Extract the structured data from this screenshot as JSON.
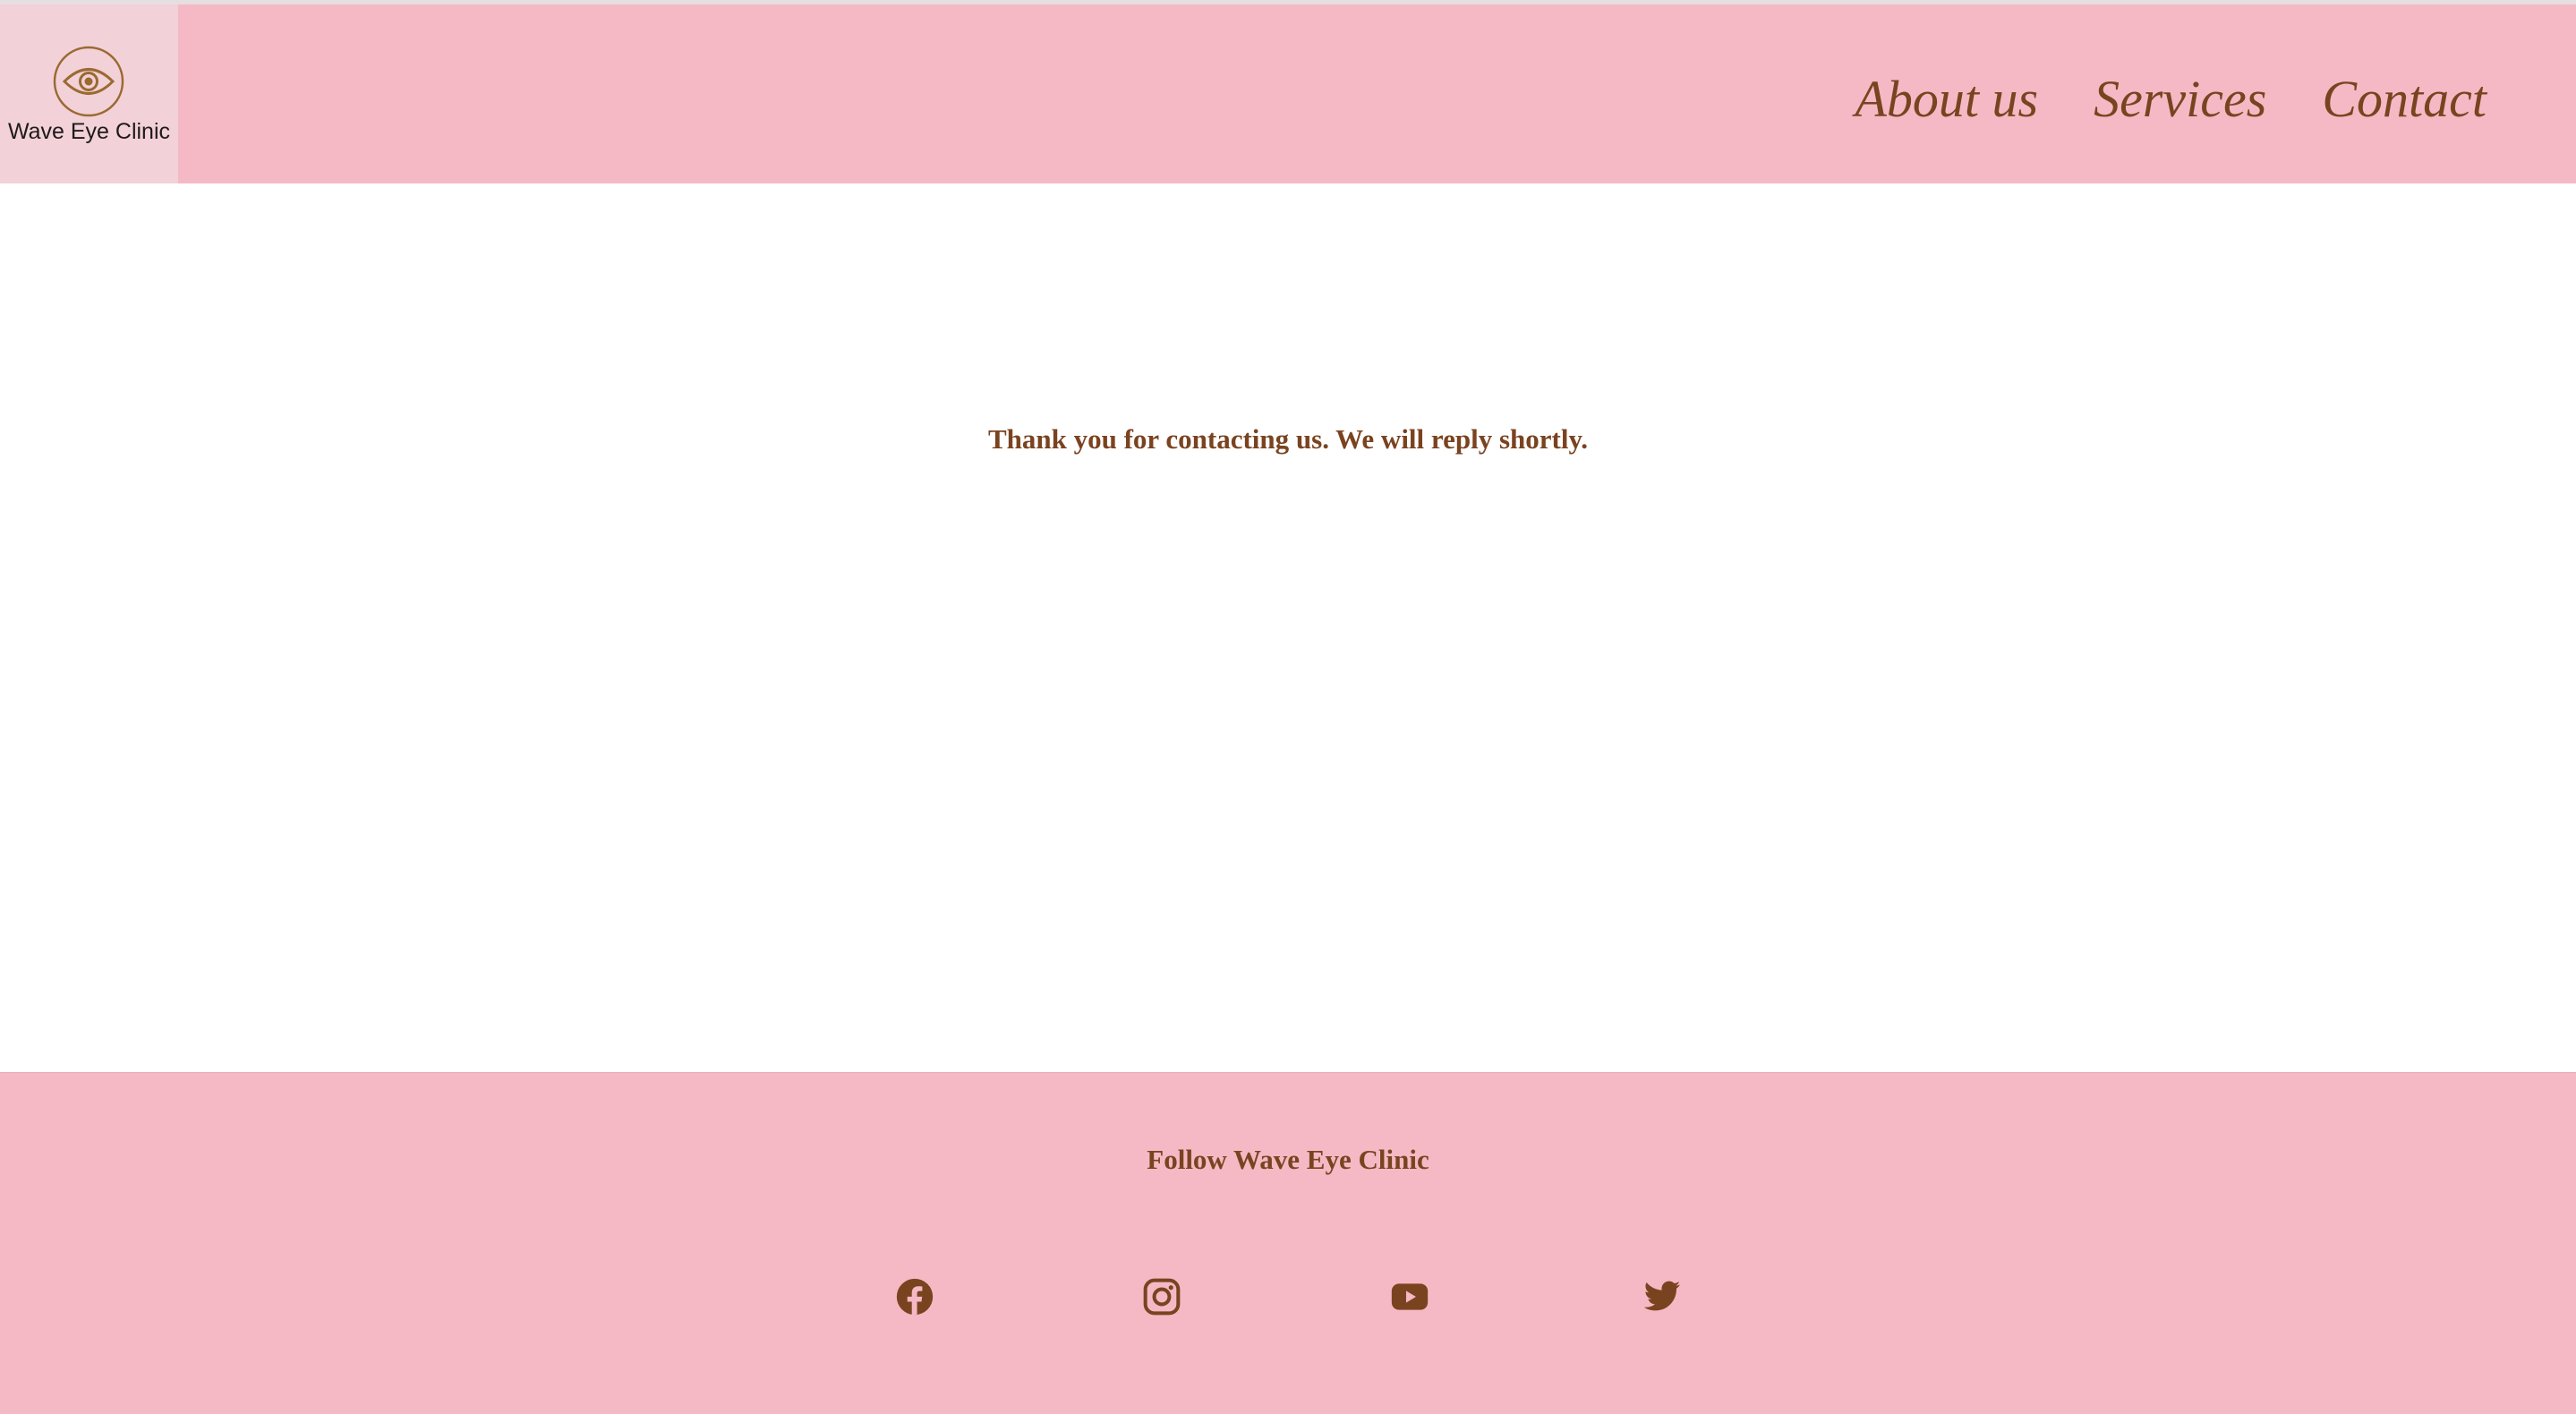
{
  "brand": {
    "name": "Wave Eye Clinic",
    "logo_icon": "eye-icon"
  },
  "nav": {
    "items": [
      {
        "label": "About us"
      },
      {
        "label": "Services"
      },
      {
        "label": "Contact"
      }
    ]
  },
  "main": {
    "message": "Thank you for contacting us. We will reply shortly."
  },
  "footer": {
    "heading": "Follow Wave Eye Clinic",
    "social": [
      "facebook-icon",
      "instagram-icon",
      "youtube-icon",
      "twitter-icon"
    ]
  },
  "colors": {
    "header_bg": "#f4b9c4",
    "logo_bg": "#f2d1d9",
    "accent_brown": "#7a4320",
    "page_bg": "#ffffff"
  }
}
